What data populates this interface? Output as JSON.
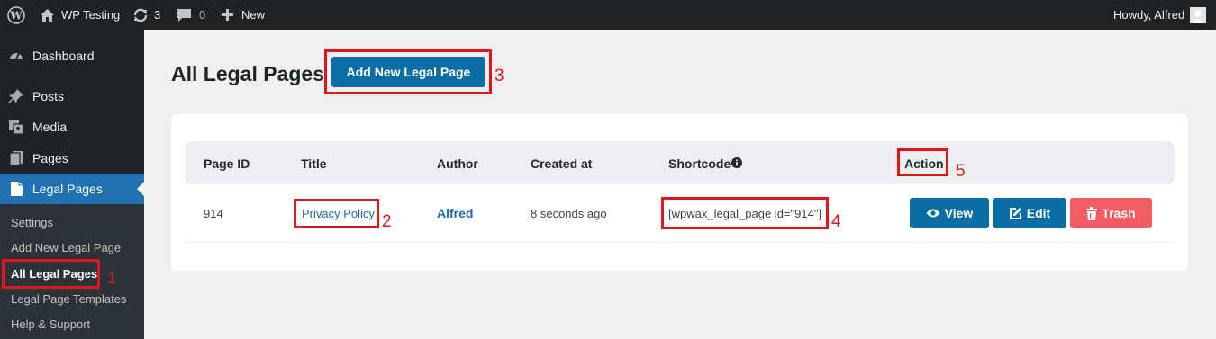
{
  "admin_bar": {
    "wp_logo_icon": "wordpress-icon",
    "site_name": "WP Testing",
    "updates_count": "3",
    "comments_count": "0",
    "new_label": "New",
    "greeting": "Howdy, Alfred"
  },
  "sidebar": {
    "items": [
      {
        "label": "Dashboard",
        "icon": "dashboard-icon"
      },
      {
        "label": "Posts",
        "icon": "pin-icon"
      },
      {
        "label": "Media",
        "icon": "media-icon"
      },
      {
        "label": "Pages",
        "icon": "pages-icon"
      },
      {
        "label": "Legal Pages",
        "icon": "document-icon",
        "current": true
      }
    ],
    "submenu": [
      {
        "label": "Settings"
      },
      {
        "label": "Add New Legal Page"
      },
      {
        "label": "All Legal Pages",
        "current": true
      },
      {
        "label": "Legal Page Templates"
      },
      {
        "label": "Help & Support"
      }
    ]
  },
  "main": {
    "title": "All Legal Pages",
    "add_new_label": "Add New Legal Page"
  },
  "table": {
    "headers": [
      "Page ID",
      "Title",
      "Author",
      "Created at",
      "Shortcode",
      "Action"
    ],
    "shortcode_info_icon": "info-icon",
    "rows": [
      {
        "page_id": "914",
        "title": "Privacy Policy",
        "author": "Alfred",
        "created_at": "8 seconds ago",
        "shortcode": "[wpwax_legal_page id=\"914\"]",
        "actions": {
          "view": "View",
          "edit": "Edit",
          "trash": "Trash"
        }
      }
    ]
  },
  "annotations": [
    "1",
    "2",
    "3",
    "4",
    "5"
  ],
  "colors": {
    "admin_bar_bg": "#1d2327",
    "primary_button": "#0a6ea5",
    "trash_button": "#f25c63",
    "annotation_red": "#e0161d",
    "active_menu": "#2271b1"
  }
}
